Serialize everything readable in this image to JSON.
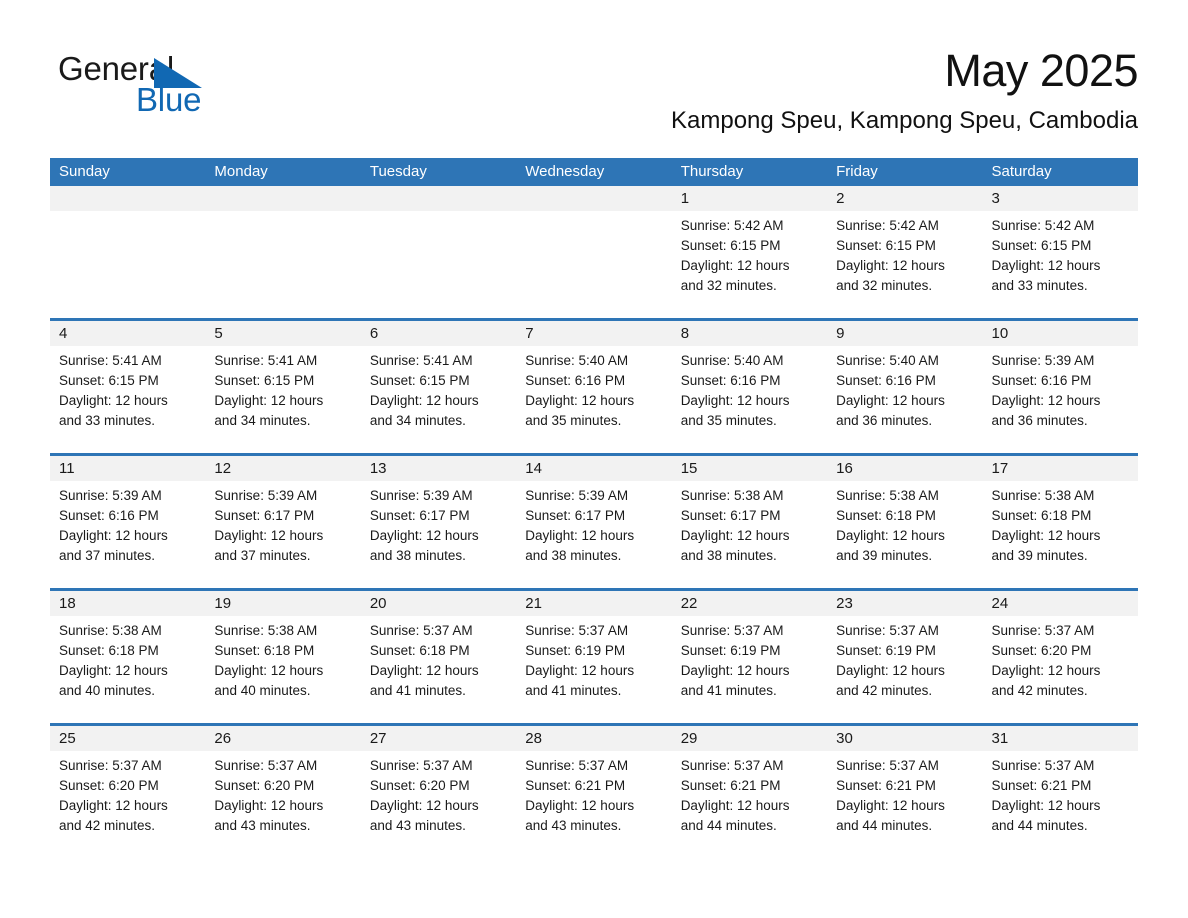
{
  "brand": {
    "name_part1": "General",
    "name_part2": "Blue",
    "triangle_color": "#1168b3",
    "text_color": "#1a1a1a"
  },
  "header": {
    "title": "May 2025",
    "subtitle": "Kampong Speu, Kampong Speu, Cambodia"
  },
  "theme": {
    "header_blue": "#2e75b6",
    "band_gray": "#f2f2f2",
    "page_bg": "#ffffff"
  },
  "calendar": {
    "weekday_headers": [
      "Sunday",
      "Monday",
      "Tuesday",
      "Wednesday",
      "Thursday",
      "Friday",
      "Saturday"
    ],
    "weeks": [
      [
        {
          "day": "",
          "lines": []
        },
        {
          "day": "",
          "lines": []
        },
        {
          "day": "",
          "lines": []
        },
        {
          "day": "",
          "lines": []
        },
        {
          "day": "1",
          "lines": [
            "Sunrise: 5:42 AM",
            "Sunset: 6:15 PM",
            "Daylight: 12 hours",
            "and 32 minutes."
          ]
        },
        {
          "day": "2",
          "lines": [
            "Sunrise: 5:42 AM",
            "Sunset: 6:15 PM",
            "Daylight: 12 hours",
            "and 32 minutes."
          ]
        },
        {
          "day": "3",
          "lines": [
            "Sunrise: 5:42 AM",
            "Sunset: 6:15 PM",
            "Daylight: 12 hours",
            "and 33 minutes."
          ]
        }
      ],
      [
        {
          "day": "4",
          "lines": [
            "Sunrise: 5:41 AM",
            "Sunset: 6:15 PM",
            "Daylight: 12 hours",
            "and 33 minutes."
          ]
        },
        {
          "day": "5",
          "lines": [
            "Sunrise: 5:41 AM",
            "Sunset: 6:15 PM",
            "Daylight: 12 hours",
            "and 34 minutes."
          ]
        },
        {
          "day": "6",
          "lines": [
            "Sunrise: 5:41 AM",
            "Sunset: 6:15 PM",
            "Daylight: 12 hours",
            "and 34 minutes."
          ]
        },
        {
          "day": "7",
          "lines": [
            "Sunrise: 5:40 AM",
            "Sunset: 6:16 PM",
            "Daylight: 12 hours",
            "and 35 minutes."
          ]
        },
        {
          "day": "8",
          "lines": [
            "Sunrise: 5:40 AM",
            "Sunset: 6:16 PM",
            "Daylight: 12 hours",
            "and 35 minutes."
          ]
        },
        {
          "day": "9",
          "lines": [
            "Sunrise: 5:40 AM",
            "Sunset: 6:16 PM",
            "Daylight: 12 hours",
            "and 36 minutes."
          ]
        },
        {
          "day": "10",
          "lines": [
            "Sunrise: 5:39 AM",
            "Sunset: 6:16 PM",
            "Daylight: 12 hours",
            "and 36 minutes."
          ]
        }
      ],
      [
        {
          "day": "11",
          "lines": [
            "Sunrise: 5:39 AM",
            "Sunset: 6:16 PM",
            "Daylight: 12 hours",
            "and 37 minutes."
          ]
        },
        {
          "day": "12",
          "lines": [
            "Sunrise: 5:39 AM",
            "Sunset: 6:17 PM",
            "Daylight: 12 hours",
            "and 37 minutes."
          ]
        },
        {
          "day": "13",
          "lines": [
            "Sunrise: 5:39 AM",
            "Sunset: 6:17 PM",
            "Daylight: 12 hours",
            "and 38 minutes."
          ]
        },
        {
          "day": "14",
          "lines": [
            "Sunrise: 5:39 AM",
            "Sunset: 6:17 PM",
            "Daylight: 12 hours",
            "and 38 minutes."
          ]
        },
        {
          "day": "15",
          "lines": [
            "Sunrise: 5:38 AM",
            "Sunset: 6:17 PM",
            "Daylight: 12 hours",
            "and 38 minutes."
          ]
        },
        {
          "day": "16",
          "lines": [
            "Sunrise: 5:38 AM",
            "Sunset: 6:18 PM",
            "Daylight: 12 hours",
            "and 39 minutes."
          ]
        },
        {
          "day": "17",
          "lines": [
            "Sunrise: 5:38 AM",
            "Sunset: 6:18 PM",
            "Daylight: 12 hours",
            "and 39 minutes."
          ]
        }
      ],
      [
        {
          "day": "18",
          "lines": [
            "Sunrise: 5:38 AM",
            "Sunset: 6:18 PM",
            "Daylight: 12 hours",
            "and 40 minutes."
          ]
        },
        {
          "day": "19",
          "lines": [
            "Sunrise: 5:38 AM",
            "Sunset: 6:18 PM",
            "Daylight: 12 hours",
            "and 40 minutes."
          ]
        },
        {
          "day": "20",
          "lines": [
            "Sunrise: 5:37 AM",
            "Sunset: 6:18 PM",
            "Daylight: 12 hours",
            "and 41 minutes."
          ]
        },
        {
          "day": "21",
          "lines": [
            "Sunrise: 5:37 AM",
            "Sunset: 6:19 PM",
            "Daylight: 12 hours",
            "and 41 minutes."
          ]
        },
        {
          "day": "22",
          "lines": [
            "Sunrise: 5:37 AM",
            "Sunset: 6:19 PM",
            "Daylight: 12 hours",
            "and 41 minutes."
          ]
        },
        {
          "day": "23",
          "lines": [
            "Sunrise: 5:37 AM",
            "Sunset: 6:19 PM",
            "Daylight: 12 hours",
            "and 42 minutes."
          ]
        },
        {
          "day": "24",
          "lines": [
            "Sunrise: 5:37 AM",
            "Sunset: 6:20 PM",
            "Daylight: 12 hours",
            "and 42 minutes."
          ]
        }
      ],
      [
        {
          "day": "25",
          "lines": [
            "Sunrise: 5:37 AM",
            "Sunset: 6:20 PM",
            "Daylight: 12 hours",
            "and 42 minutes."
          ]
        },
        {
          "day": "26",
          "lines": [
            "Sunrise: 5:37 AM",
            "Sunset: 6:20 PM",
            "Daylight: 12 hours",
            "and 43 minutes."
          ]
        },
        {
          "day": "27",
          "lines": [
            "Sunrise: 5:37 AM",
            "Sunset: 6:20 PM",
            "Daylight: 12 hours",
            "and 43 minutes."
          ]
        },
        {
          "day": "28",
          "lines": [
            "Sunrise: 5:37 AM",
            "Sunset: 6:21 PM",
            "Daylight: 12 hours",
            "and 43 minutes."
          ]
        },
        {
          "day": "29",
          "lines": [
            "Sunrise: 5:37 AM",
            "Sunset: 6:21 PM",
            "Daylight: 12 hours",
            "and 44 minutes."
          ]
        },
        {
          "day": "30",
          "lines": [
            "Sunrise: 5:37 AM",
            "Sunset: 6:21 PM",
            "Daylight: 12 hours",
            "and 44 minutes."
          ]
        },
        {
          "day": "31",
          "lines": [
            "Sunrise: 5:37 AM",
            "Sunset: 6:21 PM",
            "Daylight: 12 hours",
            "and 44 minutes."
          ]
        }
      ]
    ]
  }
}
